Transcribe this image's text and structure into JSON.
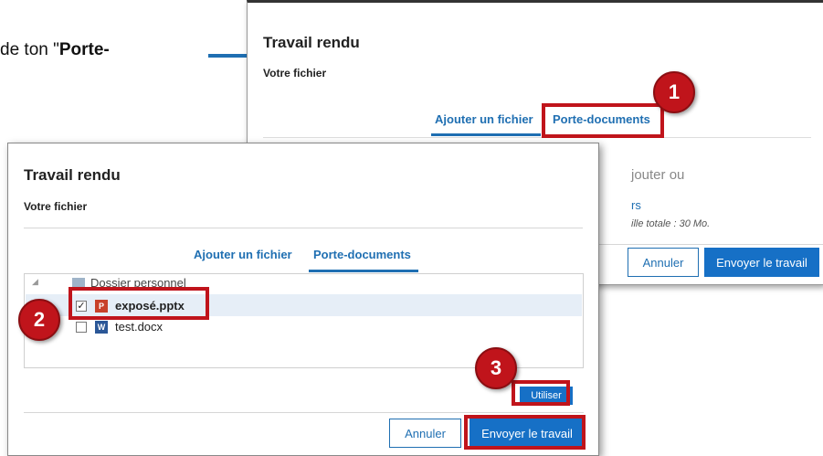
{
  "intro": {
    "prefix": "de ton \"",
    "bold": "Porte-"
  },
  "back_dialog": {
    "title": "Travail rendu",
    "subtitle": "Votre fichier",
    "tab_add": "Ajouter un fichier",
    "tab_folder": "Porte-documents",
    "drop_text": "jouter ou",
    "link_text": "rs",
    "size_note": "ille totale : 30 Mo.",
    "cancel": "Annuler",
    "submit": "Envoyer le travail"
  },
  "front_dialog": {
    "title": "Travail rendu",
    "subtitle": "Votre fichier",
    "tab_add": "Ajouter un fichier",
    "tab_folder": "Porte-documents",
    "folder": "Dossier personnel",
    "files": [
      {
        "name": "exposé.pptx",
        "checked": true,
        "type": "pptx"
      },
      {
        "name": "test.docx",
        "checked": false,
        "type": "docx"
      }
    ],
    "use_button": "Utiliser",
    "cancel": "Annuler",
    "submit": "Envoyer le travail"
  },
  "badges": [
    "1",
    "2",
    "3"
  ],
  "colors": {
    "accent": "#1f6fb2",
    "primary": "#1670c6",
    "highlight": "#c0141b"
  }
}
